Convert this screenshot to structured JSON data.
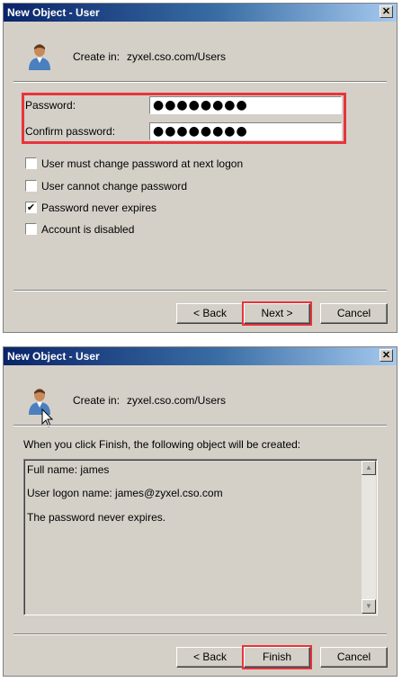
{
  "dialog1": {
    "title": "New Object - User",
    "close_symbol": "✕",
    "create_in_label": "Create in:",
    "create_in_value": "zyxel.cso.com/Users",
    "password_label": "Password:",
    "password_value": "●●●●●●●●",
    "confirm_label": "Confirm password:",
    "confirm_value": "●●●●●●●●",
    "checkboxes": [
      {
        "label": "User must change password at next logon",
        "mark": ""
      },
      {
        "label": "User cannot change password",
        "mark": ""
      },
      {
        "label": "Password never expires",
        "mark": "✔"
      },
      {
        "label": "Account is disabled",
        "mark": ""
      }
    ],
    "back_label": "< Back",
    "next_label": "Next >",
    "cancel_label": "Cancel"
  },
  "dialog2": {
    "title": "New Object - User",
    "close_symbol": "✕",
    "create_in_label": "Create in:",
    "create_in_value": "zyxel.cso.com/Users",
    "summary_intro": "When you click Finish, the following object will be created:",
    "summary_lines": [
      "Full name: james",
      "User logon name: james@zyxel.cso.com",
      "The password never expires."
    ],
    "scroll_up": "▲",
    "scroll_down": "▼",
    "back_label": "< Back",
    "finish_label": "Finish",
    "cancel_label": "Cancel"
  },
  "colors": {
    "highlight": "#e8343c",
    "titlebar_start": "#0a246a",
    "titlebar_end": "#a6caf0",
    "dialog_bg": "#d4d0c8"
  },
  "icons": [
    "user-icon",
    "close-icon",
    "checkmark-icon",
    "scroll-up-icon",
    "scroll-down-icon",
    "mouse-cursor-icon"
  ]
}
